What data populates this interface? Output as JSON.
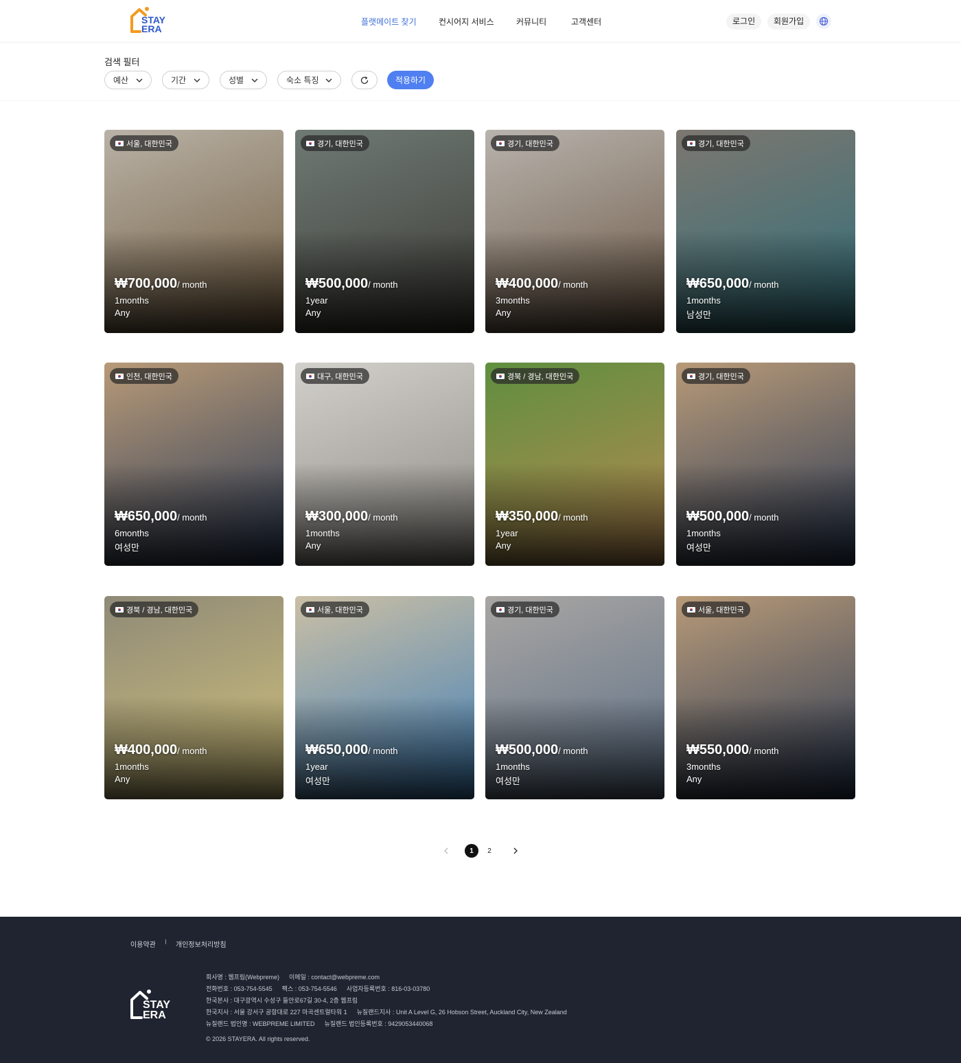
{
  "header": {
    "logo_text_top": "STAY",
    "logo_text_bottom": "ERA",
    "nav": [
      "플랫메이트 찾기",
      "컨시어지 서비스",
      "커뮤니티",
      "고객센터"
    ],
    "login": "로그인",
    "signup": "회원가입"
  },
  "filter": {
    "title": "검색 필터",
    "buttons": [
      "예산",
      "기간",
      "성별",
      "숙소 특징"
    ],
    "apply": "적용하기"
  },
  "listings": [
    {
      "location": "서울, 대한민국",
      "price": "₩700,000",
      "per": "/ month",
      "duration": "1months",
      "gender": "Any"
    },
    {
      "location": "경기, 대한민국",
      "price": "₩500,000",
      "per": "/ month",
      "duration": "1year",
      "gender": "Any"
    },
    {
      "location": "경기, 대한민국",
      "price": "₩400,000",
      "per": "/ month",
      "duration": "3months",
      "gender": "Any"
    },
    {
      "location": "경기, 대한민국",
      "price": "₩650,000",
      "per": "/ month",
      "duration": "1months",
      "gender": "남성만"
    },
    {
      "location": "인천, 대한민국",
      "price": "₩650,000",
      "per": "/ month",
      "duration": "6months",
      "gender": "여성만"
    },
    {
      "location": "대구, 대한민국",
      "price": "₩300,000",
      "per": "/ month",
      "duration": "1months",
      "gender": "Any"
    },
    {
      "location": "경북 / 경남, 대한민국",
      "price": "₩350,000",
      "per": "/ month",
      "duration": "1year",
      "gender": "Any"
    },
    {
      "location": "경기, 대한민국",
      "price": "₩500,000",
      "per": "/ month",
      "duration": "1months",
      "gender": "여성만"
    },
    {
      "location": "경북 / 경남, 대한민국",
      "price": "₩400,000",
      "per": "/ month",
      "duration": "1months",
      "gender": "Any"
    },
    {
      "location": "서울, 대한민국",
      "price": "₩650,000",
      "per": "/ month",
      "duration": "1year",
      "gender": "여성만"
    },
    {
      "location": "경기, 대한민국",
      "price": "₩500,000",
      "per": "/ month",
      "duration": "1months",
      "gender": "여성만"
    },
    {
      "location": "서울, 대한민국",
      "price": "₩550,000",
      "per": "/ month",
      "duration": "3months",
      "gender": "Any"
    }
  ],
  "photo_colors": [
    [
      "#b9b2a6",
      "#6f5a3e"
    ],
    [
      "#6f7a74",
      "#3c3a35"
    ],
    [
      "#b8b3ad",
      "#6b5744"
    ],
    [
      "#7d7770",
      "#2f6f7a"
    ],
    [
      "#b89a78",
      "#2a3a55"
    ],
    [
      "#d2d0cb",
      "#8d8a84"
    ],
    [
      "#5f8f3f",
      "#b98a52"
    ],
    [
      "#b89a78",
      "#2a3a55"
    ],
    [
      "#8f8a78",
      "#d2c27a"
    ],
    [
      "#cbbfa5",
      "#3f7fb8"
    ],
    [
      "#a9a6a3",
      "#5c6f86"
    ],
    [
      "#b89a78",
      "#2a3a55"
    ]
  ],
  "pagination": {
    "pages": [
      "1",
      "2"
    ],
    "current": "1"
  },
  "footer": {
    "terms": "이용약관",
    "separator": "I",
    "privacy": "개인정보처리방침",
    "lines": [
      [
        "회사명 : 웹프림(Webpreme)",
        "이메일 : contact@webpreme.com"
      ],
      [
        "전화번호 : 053-754-5545",
        "팩스 : 053-754-5546",
        "사업자등록번호 : 816-03-03780"
      ],
      [
        "한국본사 : 대구광역시 수성구 들안로67길 30-4, 2층 웹프림"
      ],
      [
        "한국지사 : 서울 강서구 공항대로 227 마곡센트럴타워 1",
        "뉴질랜드지사 : Unit A Level G, 26 Hobson Street, Auckland City, New Zealand"
      ],
      [
        "뉴질랜드 법인명 : WEBPREME LIMITED",
        "뉴질랜드 법인등록번호 : 9429053440068"
      ]
    ],
    "copyright": "© 2026 STAYERA. All rights reserved."
  },
  "colors": {
    "accent": "#4f7ff0",
    "nav_active": "#3f6fd8",
    "footer_bg": "#1f2430",
    "logo_orange": "#f39a1f",
    "logo_blue": "#2f57c9"
  }
}
